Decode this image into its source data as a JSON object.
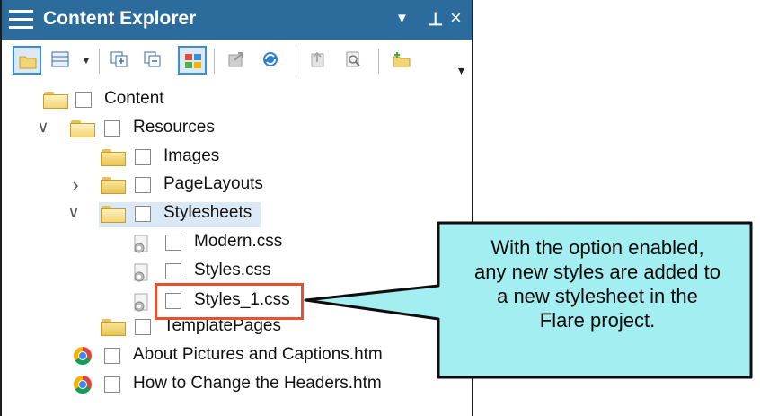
{
  "panel": {
    "title": "Content Explorer",
    "controls": {
      "dropdown": "▼",
      "pin": "⊥",
      "close": "×"
    }
  },
  "toolbar": {
    "buttons": [
      "folder-button",
      "grid-view-button",
      "expand-all-button",
      "collapse-all-button",
      "icons-view-button",
      "export-button",
      "refresh-button",
      "page-button",
      "search-button",
      "new-folder-button"
    ],
    "overflow": "▾"
  },
  "tree": {
    "items": [
      {
        "label": "Content"
      },
      {
        "label": "Resources",
        "chevron": "∨"
      },
      {
        "label": "Images"
      },
      {
        "label": "PageLayouts",
        "chevron": "›"
      },
      {
        "label": "Stylesheets",
        "chevron": "∨"
      },
      {
        "label": "Modern.css"
      },
      {
        "label": "Styles.css"
      },
      {
        "label": "Styles_1.css"
      },
      {
        "label": "TemplatePages"
      },
      {
        "label": "About Pictures and Captions.htm"
      },
      {
        "label": "How to Change the Headers.htm"
      }
    ]
  },
  "callout": {
    "lines": [
      "With the option enabled,",
      "any new styles are added to",
      "a new stylesheet in the",
      "Flare project."
    ],
    "fill": "#a3eef0",
    "highlight_border": "#e8502f"
  },
  "colors": {
    "titlebar": "#2b6c9c",
    "selection": "#dbe9f7",
    "accent": "#3a8ed6"
  }
}
